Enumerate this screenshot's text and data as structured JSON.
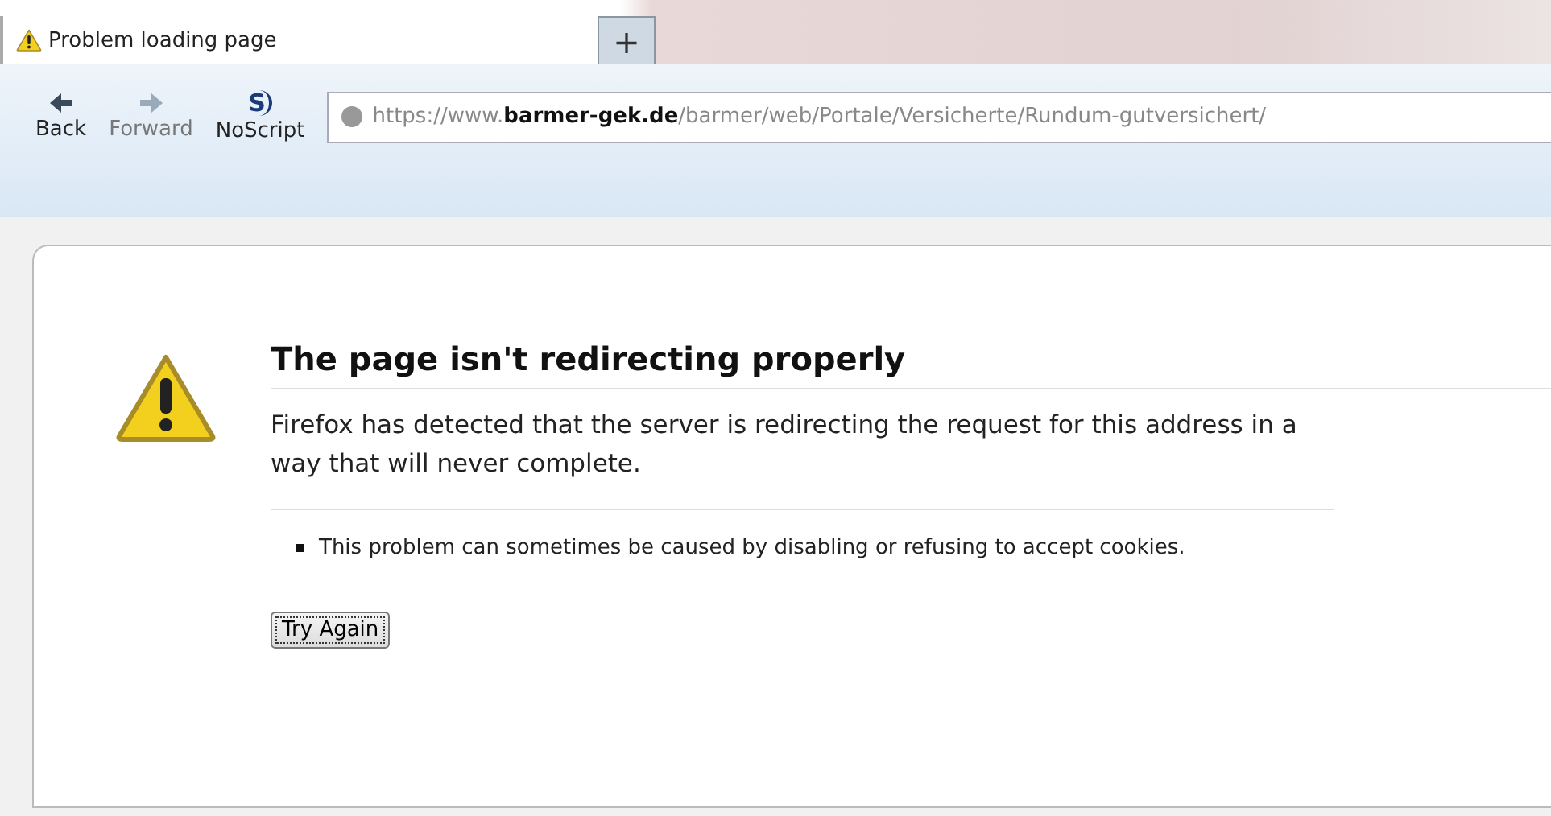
{
  "tabs": [
    {
      "label": "Problem loading page",
      "selected": true
    }
  ],
  "new_tab_button": "+",
  "toolbar": {
    "buttons": [
      {
        "kind": "back",
        "label": "Back",
        "disabled": false
      },
      {
        "kind": "forward",
        "label": "Forward",
        "disabled": true
      },
      {
        "kind": "noscript",
        "label": "NoScript",
        "disabled": false,
        "icon_text": "S"
      }
    ],
    "address": "https://www.**barmer-gek.de**/barmer/web/Portale/Versicherte/Rundum-gutversichert/"
  },
  "error": {
    "title": "The page isn't redirecting properly",
    "description": "Firefox has detected that the server is redirecting the request for this address in a way that will never complete.",
    "bullets": [
      "This problem can sometimes be caused by disabling or refusing to accept cookies."
    ],
    "button": "Try Again"
  }
}
